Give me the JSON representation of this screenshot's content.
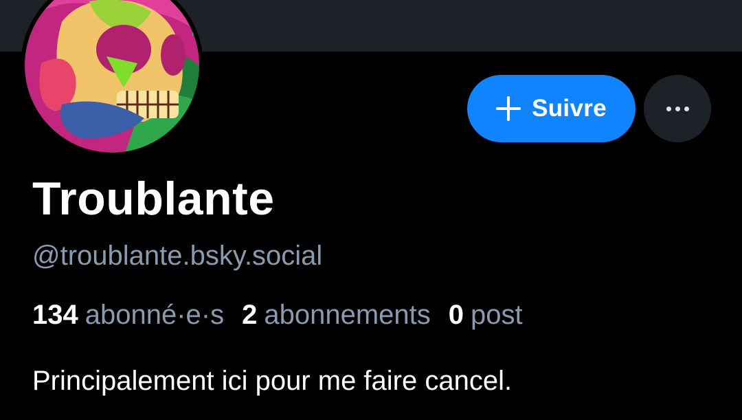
{
  "profile": {
    "display_name": "Troublante",
    "handle": "@troublante.bsky.social",
    "bio": "Principalement ici pour me faire cancel."
  },
  "actions": {
    "follow_label": "Suivre",
    "follow_icon": "plus-icon",
    "more_icon": "ellipsis-icon"
  },
  "stats": {
    "followers_count": "134",
    "followers_label": "abonné·e·s",
    "following_count": "2",
    "following_label": "abonnements",
    "posts_count": "0",
    "posts_label": "post"
  },
  "colors": {
    "accent": "#1083fe",
    "background": "#000000",
    "banner": "#1c2228",
    "muted_text": "#8a9bb0"
  }
}
